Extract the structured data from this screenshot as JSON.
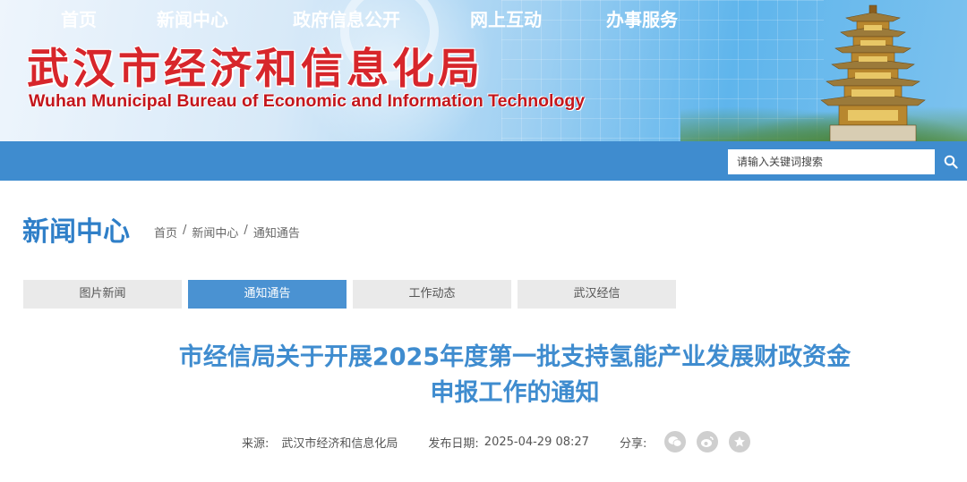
{
  "header": {
    "title_cn": "武汉市经济和信息化局",
    "title_en": "Wuhan Municipal Bureau of Economic and Information Technology"
  },
  "nav": {
    "items": [
      {
        "label": "首页"
      },
      {
        "label": "新闻中心"
      },
      {
        "label": "政府信息公开"
      },
      {
        "label": "网上互动"
      },
      {
        "label": "办事服务"
      }
    ],
    "search_placeholder": "请输入关键词搜索",
    "search_icon": "search-icon"
  },
  "section": {
    "title": "新闻中心",
    "breadcrumb": [
      "首页",
      "新闻中心",
      "通知通告"
    ],
    "separator": "/"
  },
  "tabs": [
    {
      "label": "图片新闻",
      "active": false
    },
    {
      "label": "通知通告",
      "active": true
    },
    {
      "label": "工作动态",
      "active": false
    },
    {
      "label": "武汉经信",
      "active": false
    }
  ],
  "article": {
    "title_line1": "市经信局关于开展2025年度第一批支持氢能产业发展财政资金",
    "title_line2": "申报工作的通知",
    "source_label": "来源:",
    "source_value": "武汉市经济和信息化局",
    "date_label": "发布日期:",
    "date_value": "2025-04-29 08:27",
    "share_label": "分享:",
    "share_icons": [
      "wechat-icon",
      "weibo-icon",
      "favorite-icon"
    ]
  },
  "colors": {
    "nav_bg": "#3f8ccf",
    "title_red": "#d7262b",
    "accent_blue": "#2f7fc8",
    "tab_active": "#4a92d2",
    "tab_inactive": "#eaeaea"
  }
}
